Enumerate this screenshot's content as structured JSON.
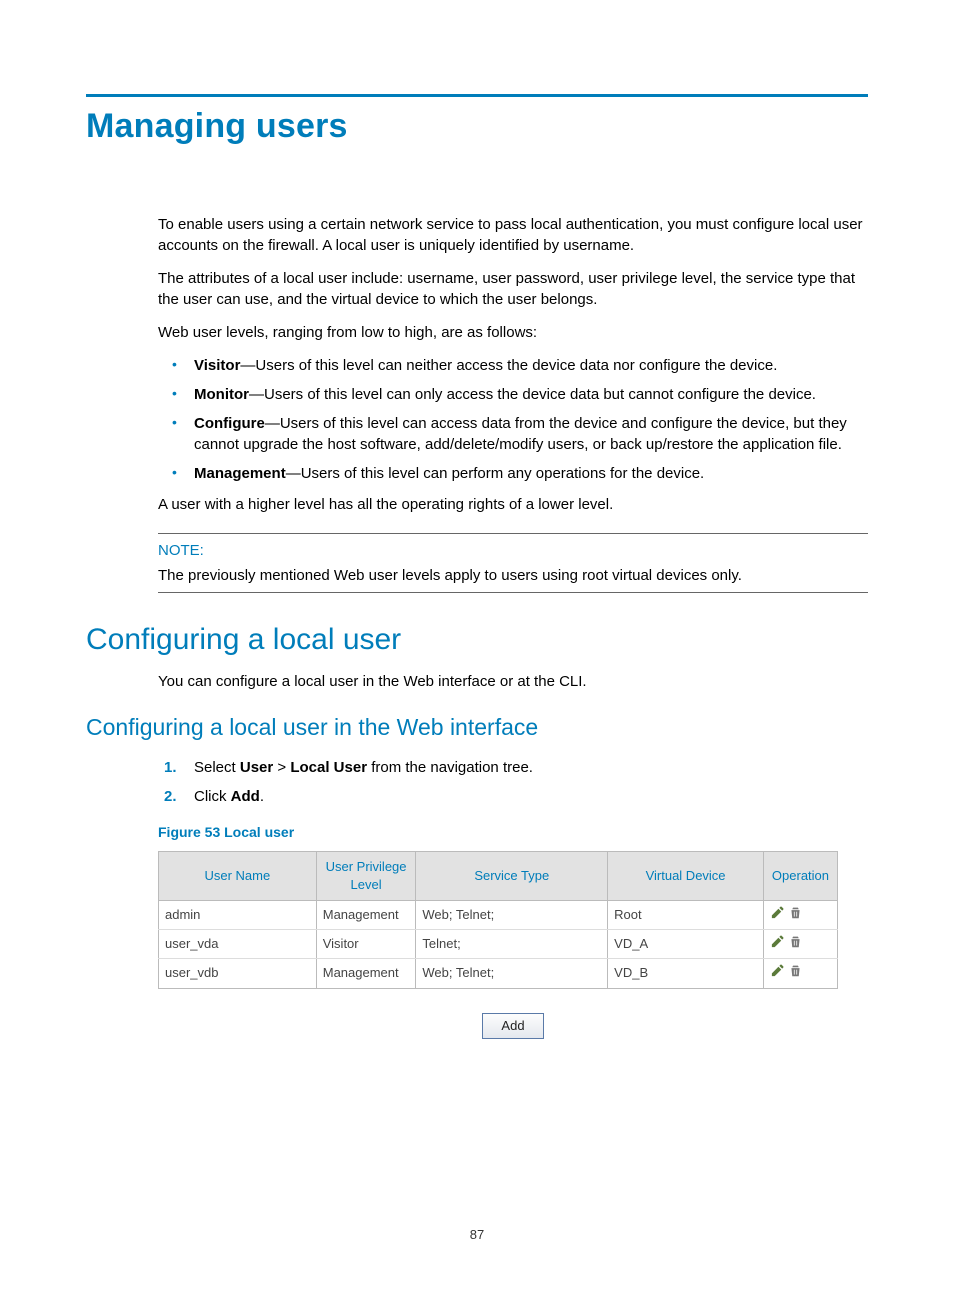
{
  "page_number": "87",
  "h1": "Managing users",
  "intro_p1": "To enable users using a certain network service to pass local authentication, you must configure local user accounts on the firewall. A local user is uniquely identified by username.",
  "intro_p2": "The attributes of a local user include: username, user password, user privilege level, the service type that the user can use, and the virtual device to which the user belongs.",
  "intro_p3": "Web user levels, ranging from low to high, are as follows:",
  "levels": [
    {
      "name": "Visitor",
      "desc": "—Users of this level can neither access the device data nor configure the device."
    },
    {
      "name": "Monitor",
      "desc": "—Users of this level can only access the device data but cannot configure the device."
    },
    {
      "name": "Configure",
      "desc": "—Users of this level can access data from the device and configure the device, but they cannot upgrade the host software, add/delete/modify users, or back up/restore the application file."
    },
    {
      "name": "Management",
      "desc": "—Users of this level can perform any operations for the device."
    }
  ],
  "intro_p4": "A user with a higher level has all the operating rights of a lower level.",
  "note_label": "NOTE:",
  "note_text": "The previously mentioned Web user levels apply to users using root virtual devices only.",
  "h2": "Configuring a local user",
  "h2_p": "You can configure a local user in the Web interface or at the CLI.",
  "h3": "Configuring a local user in the Web interface",
  "steps": {
    "s1_pre": "Select ",
    "s1_b1": "User",
    "s1_mid": " > ",
    "s1_b2": "Local User",
    "s1_post": " from the navigation tree.",
    "s2_pre": "Click ",
    "s2_b": "Add",
    "s2_post": "."
  },
  "figure_caption": "Figure 53 Local user",
  "table": {
    "headers": [
      "User Name",
      "User Privilege Level",
      "Service Type",
      "Virtual Device",
      "Operation"
    ],
    "rows": [
      {
        "user": "admin",
        "priv": "Management",
        "svc": "Web; Telnet;",
        "vd": "Root"
      },
      {
        "user": "user_vda",
        "priv": "Visitor",
        "svc": "Telnet;",
        "vd": "VD_A"
      },
      {
        "user": "user_vdb",
        "priv": "Management",
        "svc": "Web; Telnet;",
        "vd": "VD_B"
      }
    ]
  },
  "add_button": "Add"
}
